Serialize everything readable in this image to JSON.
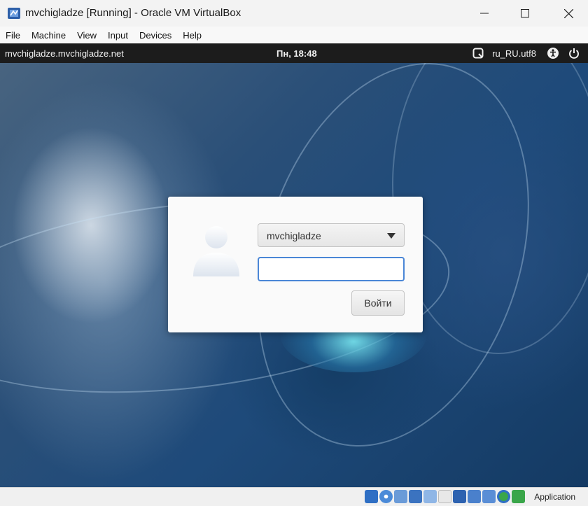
{
  "window": {
    "title": "mvchigladze [Running] - Oracle VM VirtualBox"
  },
  "menubar": {
    "items": [
      "File",
      "Machine",
      "View",
      "Input",
      "Devices",
      "Help"
    ]
  },
  "guest_topbar": {
    "hostname": "mvchigladze.mvchigladze.net",
    "clock": "Пн, 18:48",
    "locale": "ru_RU.utf8",
    "icons": [
      "keyboard-icon",
      "accessibility-icon",
      "power-icon"
    ]
  },
  "login": {
    "selected_user": "mvchigladze",
    "password_value": "",
    "login_button": "Войти"
  },
  "statusbar": {
    "host_key_label": "Application",
    "icons": [
      "hard-disk-icon",
      "optical-drive-icon",
      "audio-icon",
      "network-icon",
      "usb-icon",
      "shared-folders-icon",
      "display-icon",
      "video-capture-icon",
      "recording-icon",
      "mouse-integration-icon",
      "keyboard-capture-icon"
    ],
    "colors": {
      "blue": "#2f6fc4",
      "green": "#3aa64a"
    }
  }
}
